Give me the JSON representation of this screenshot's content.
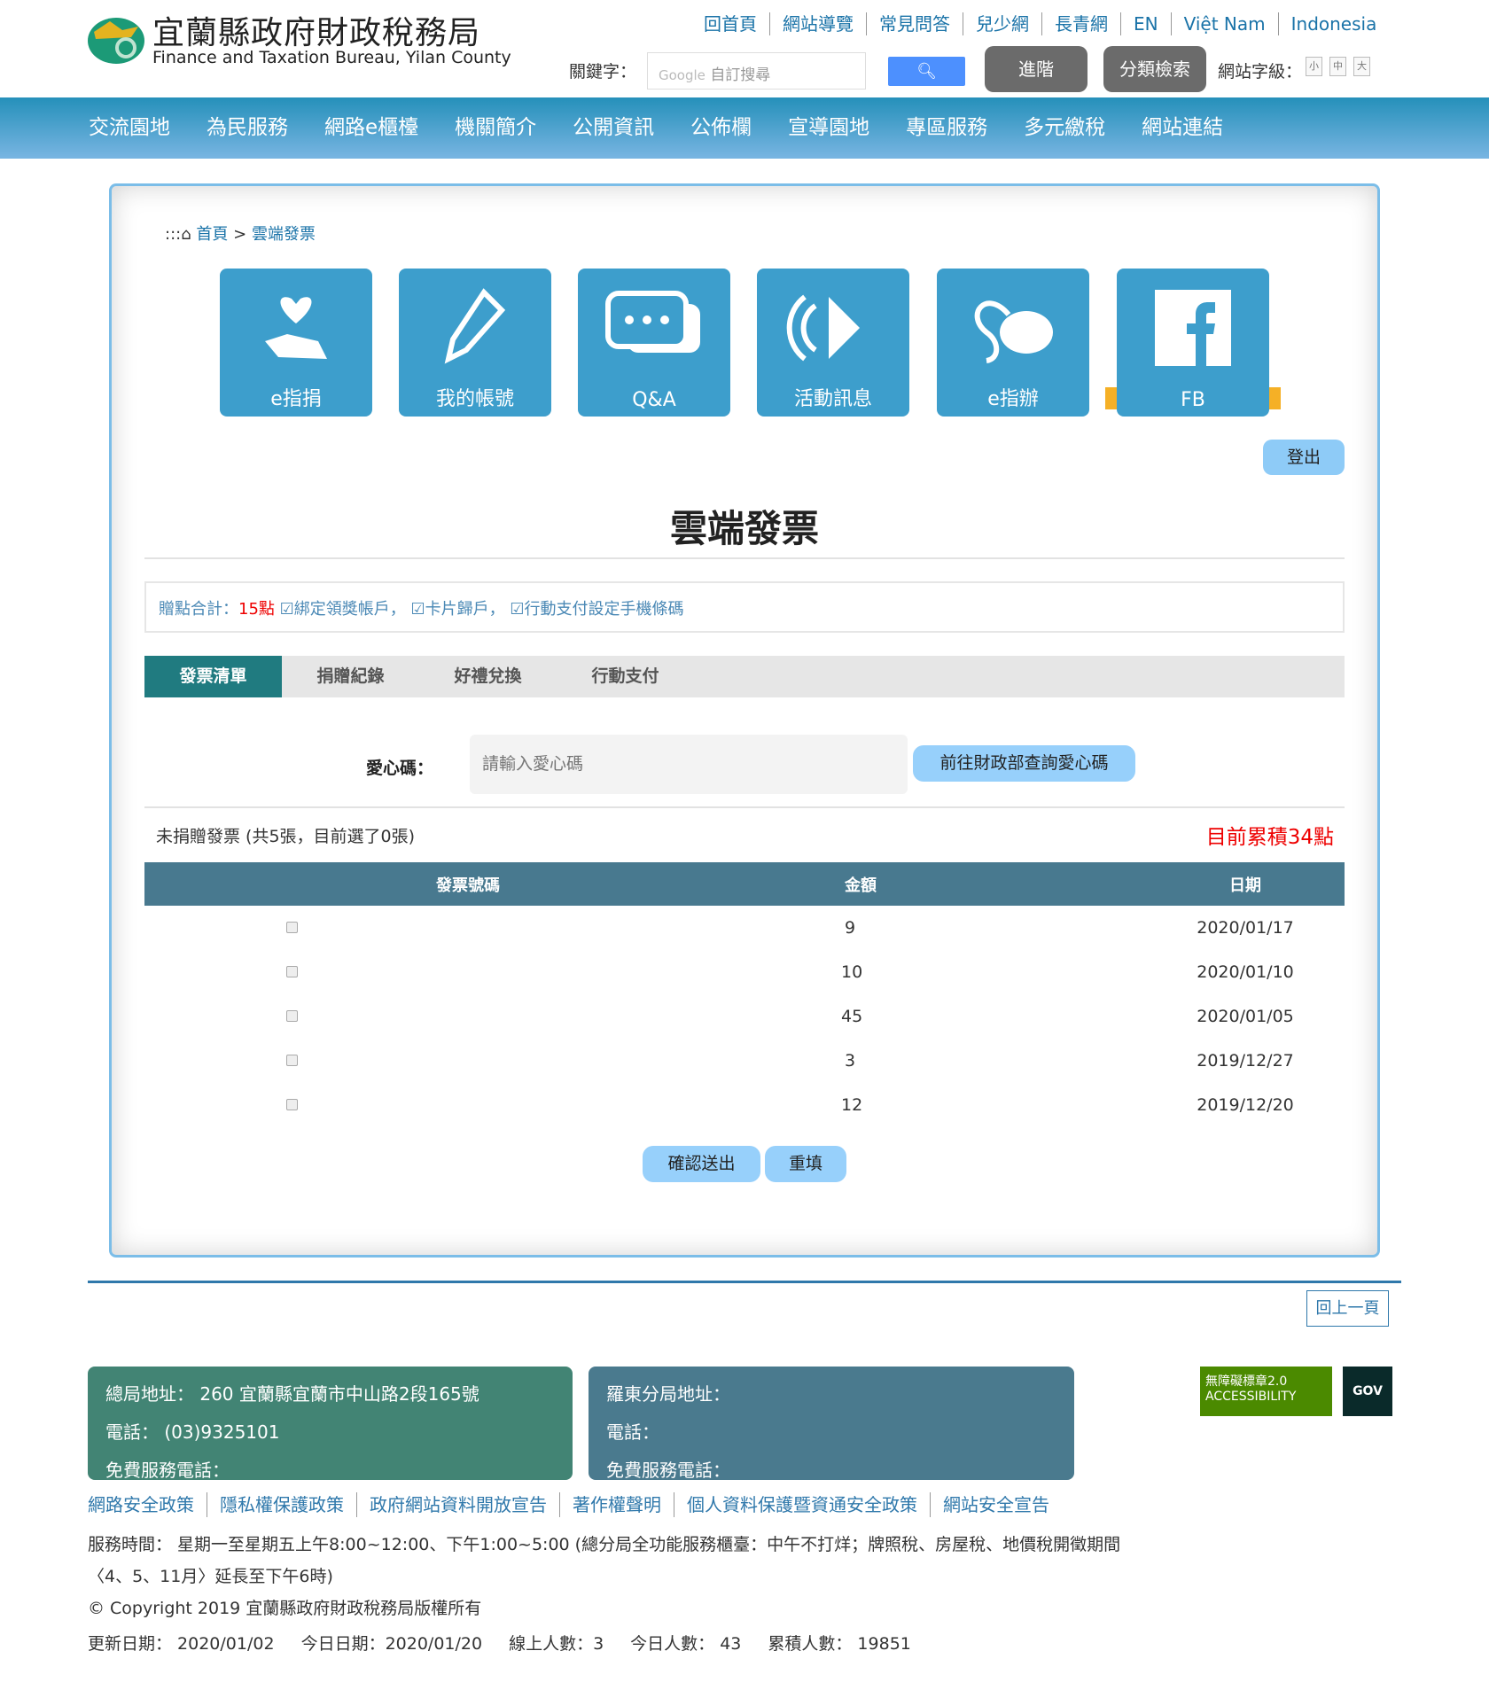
{
  "header": {
    "title_zh": "宜蘭縣政府財政稅務局",
    "title_en": "Finance and Taxation Bureau, Yilan County",
    "top_links": [
      "回首頁",
      "網站導覽",
      "常見問答",
      "兒少網",
      "長青網",
      "EN",
      "Việt Nam",
      "Indonesia"
    ],
    "keyword_label": "關鍵字：",
    "search_brand": "Google",
    "search_placeholder": "自訂搜尋",
    "advanced": "進階",
    "category_search": "分類檢索",
    "font_size_label": "網站字級：",
    "font_sizes": [
      "小",
      "中",
      "大"
    ]
  },
  "nav": [
    "交流園地",
    "為民服務",
    "網路e櫃檯",
    "機關簡介",
    "公開資訊",
    "公佈欄",
    "宣導園地",
    "專區服務",
    "多元繳稅",
    "網站連結"
  ],
  "breadcrumb": {
    "prefix": ":::",
    "home": "首頁",
    "sep": ">",
    "current": "雲端發票"
  },
  "tiles": [
    "e指捐",
    "我的帳號",
    "Q&A",
    "活動訊息",
    "e指辦",
    "FB"
  ],
  "logout": "登出",
  "page_title": "雲端發票",
  "points": {
    "label": "贈點合計：",
    "value": "15點",
    "items": [
      "☑綁定領獎帳戶，",
      "☑卡片歸戶，",
      "☑行動支付設定手機條碼"
    ]
  },
  "tabs": [
    "發票清單",
    "捐贈紀錄",
    "好禮兌換",
    "行動支付"
  ],
  "love_code": {
    "label": "愛心碼：",
    "placeholder": "請輸入愛心碼",
    "button": "前往財政部查詢愛心碼"
  },
  "summary": "未捐贈發票 (共5張，目前選了0張)",
  "accumulated": "目前累積34點",
  "table": {
    "headers": [
      "發票號碼",
      "金額",
      "日期"
    ],
    "rows": [
      {
        "amount": "9",
        "date": "2020/01/17"
      },
      {
        "amount": "10",
        "date": "2020/01/10"
      },
      {
        "amount": "45",
        "date": "2020/01/05"
      },
      {
        "amount": "3",
        "date": "2019/12/27"
      },
      {
        "amount": "12",
        "date": "2019/12/20"
      }
    ]
  },
  "actions": {
    "submit": "確認送出",
    "reset": "重填"
  },
  "back": "回上一頁",
  "footer": {
    "main": [
      "總局地址： 260 宜蘭縣宜蘭市中山路2段165號",
      "電話： (03)9325101",
      "免費服務電話："
    ],
    "branch": [
      "羅東分局地址：",
      "電話：",
      "免費服務電話："
    ],
    "links": [
      "網路安全政策",
      "隱私權保護政策",
      "政府網站資料開放宣告",
      "著作權聲明",
      "個人資料保護暨資通安全政策",
      "網站安全宣告"
    ],
    "hours1": "服務時間： 星期一至星期五上午8:00~12:00、下午1:00~5:00 (總分局全功能服務櫃臺：中午不打烊；牌照稅、房屋稅、地價稅開徵期間",
    "hours2": "〈4、5、11月〉延長至下午6時)",
    "copyright": "© Copyright 2019 宜蘭縣政府財政稅務局版權所有",
    "stats": [
      "更新日期： 2020/01/02",
      "今日日期：2020/01/20",
      "線上人數：3",
      "今日人數： 43",
      "累積人數： 19851"
    ],
    "badge_accessibility": "無障礙標章2.0 ACCESSIBILITY",
    "badge_gov": "GOV"
  }
}
